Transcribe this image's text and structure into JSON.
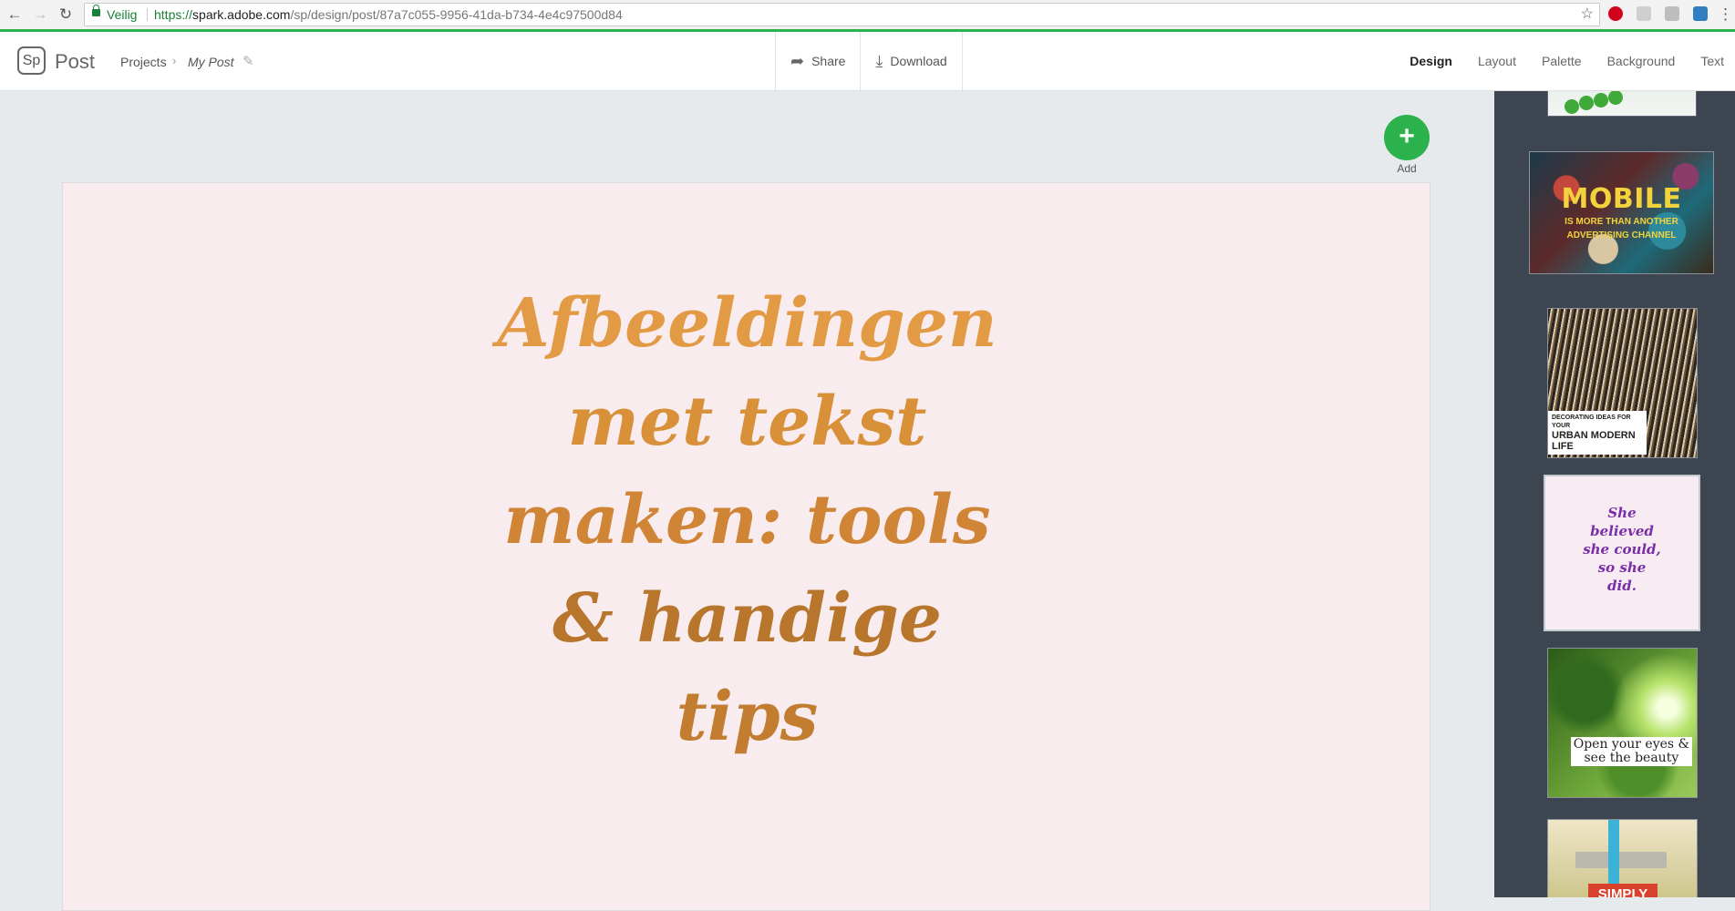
{
  "browser": {
    "security_label": "Veilig",
    "url_scheme": "https://",
    "url_host": "spark.adobe.com",
    "url_path": "/sp/design/post/87a7c055-9956-41da-b734-4e4c97500d84",
    "icons": [
      "back-arrow-icon",
      "forward-arrow-icon",
      "reload-icon",
      "lock-icon",
      "star-icon",
      "pinterest-icon",
      "extension-icon",
      "menu-dots-icon"
    ]
  },
  "header": {
    "logo_text": "Sp",
    "product_name": "Post",
    "breadcrumb_projects": "Projects",
    "document_title": "My Post",
    "share_label": "Share",
    "download_label": "Download",
    "tabs": [
      {
        "label": "Design",
        "active": true
      },
      {
        "label": "Layout",
        "active": false
      },
      {
        "label": "Palette",
        "active": false
      },
      {
        "label": "Background",
        "active": false
      },
      {
        "label": "Text",
        "active": false
      }
    ]
  },
  "canvas": {
    "add_label": "Add",
    "background_color": "#f9ecee",
    "text_color": "#d98f3a",
    "headline_lines": [
      "Afbeeldingen",
      "met tekst",
      "maken: tools",
      "& handige",
      "tips"
    ]
  },
  "sidebar": {
    "background_color": "#3c4550",
    "templates": [
      {
        "id": "green-beads"
      },
      {
        "id": "mobile",
        "title": "MOBILE",
        "lines": [
          "IS MORE THAN ANOTHER",
          "ADVERTISING CHANNEL"
        ]
      },
      {
        "id": "urban",
        "lines": [
          "DECORATING IDEAS FOR YOUR",
          "URBAN MODERN LIFE"
        ]
      },
      {
        "id": "quote",
        "lines": [
          "She",
          "believed",
          "she could,",
          "so she",
          "did."
        ],
        "selected": true
      },
      {
        "id": "eyes",
        "lines": [
          "Open your eyes &",
          "see the beauty"
        ]
      },
      {
        "id": "jar",
        "lines": [
          "SIMPLY"
        ]
      }
    ]
  }
}
